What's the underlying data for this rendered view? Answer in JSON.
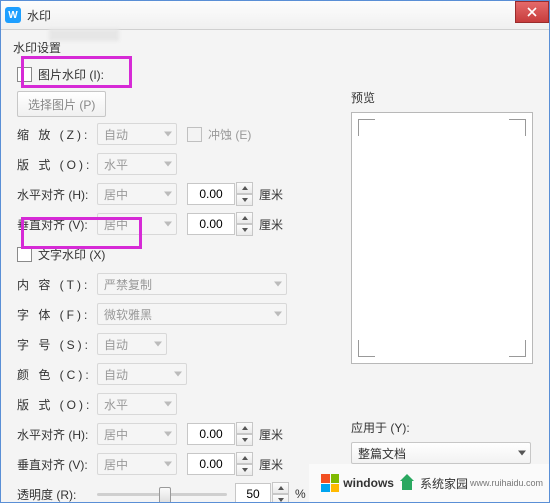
{
  "window": {
    "title": "水印",
    "app_icon_letter": "W"
  },
  "labels": {
    "settings": "水印设置",
    "picture_watermark": "图片水印 (I):",
    "select_picture": "选择图片 (P)",
    "zoom": "缩 放 (Z):",
    "washout": "冲蚀 (E)",
    "layout1": "版 式 (O):",
    "halign": "水平对齐 (H):",
    "valign": "垂直对齐 (V):",
    "text_watermark": "文字水印 (X)",
    "content": "内 容 (T):",
    "font": "字 体 (F):",
    "size": "字 号 (S):",
    "color": "颜 色 (C):",
    "layout2": "版 式 (O):",
    "halign2": "水平对齐 (H):",
    "valign2": "垂直对齐 (V):",
    "opacity": "透明度 (R):",
    "unit_cm": "厘米",
    "percent": "%",
    "preview": "预览",
    "apply_to": "应用于 (Y):"
  },
  "values": {
    "zoom": "自动",
    "layout1": "水平",
    "halign": "居中",
    "valign": "居中",
    "h_off": "0.00",
    "v_off": "0.00",
    "content": "严禁复制",
    "font": "微软雅黑",
    "size": "自动",
    "color": "自动",
    "layout2": "水平",
    "halign2": "居中",
    "valign2": "居中",
    "h_off2": "0.00",
    "v_off2": "0.00",
    "opacity": "50",
    "apply_to": "整篇文档"
  },
  "footer": {
    "brand": "windows",
    "suffix": "系统家园",
    "url": "www.ruihaidu.com"
  }
}
